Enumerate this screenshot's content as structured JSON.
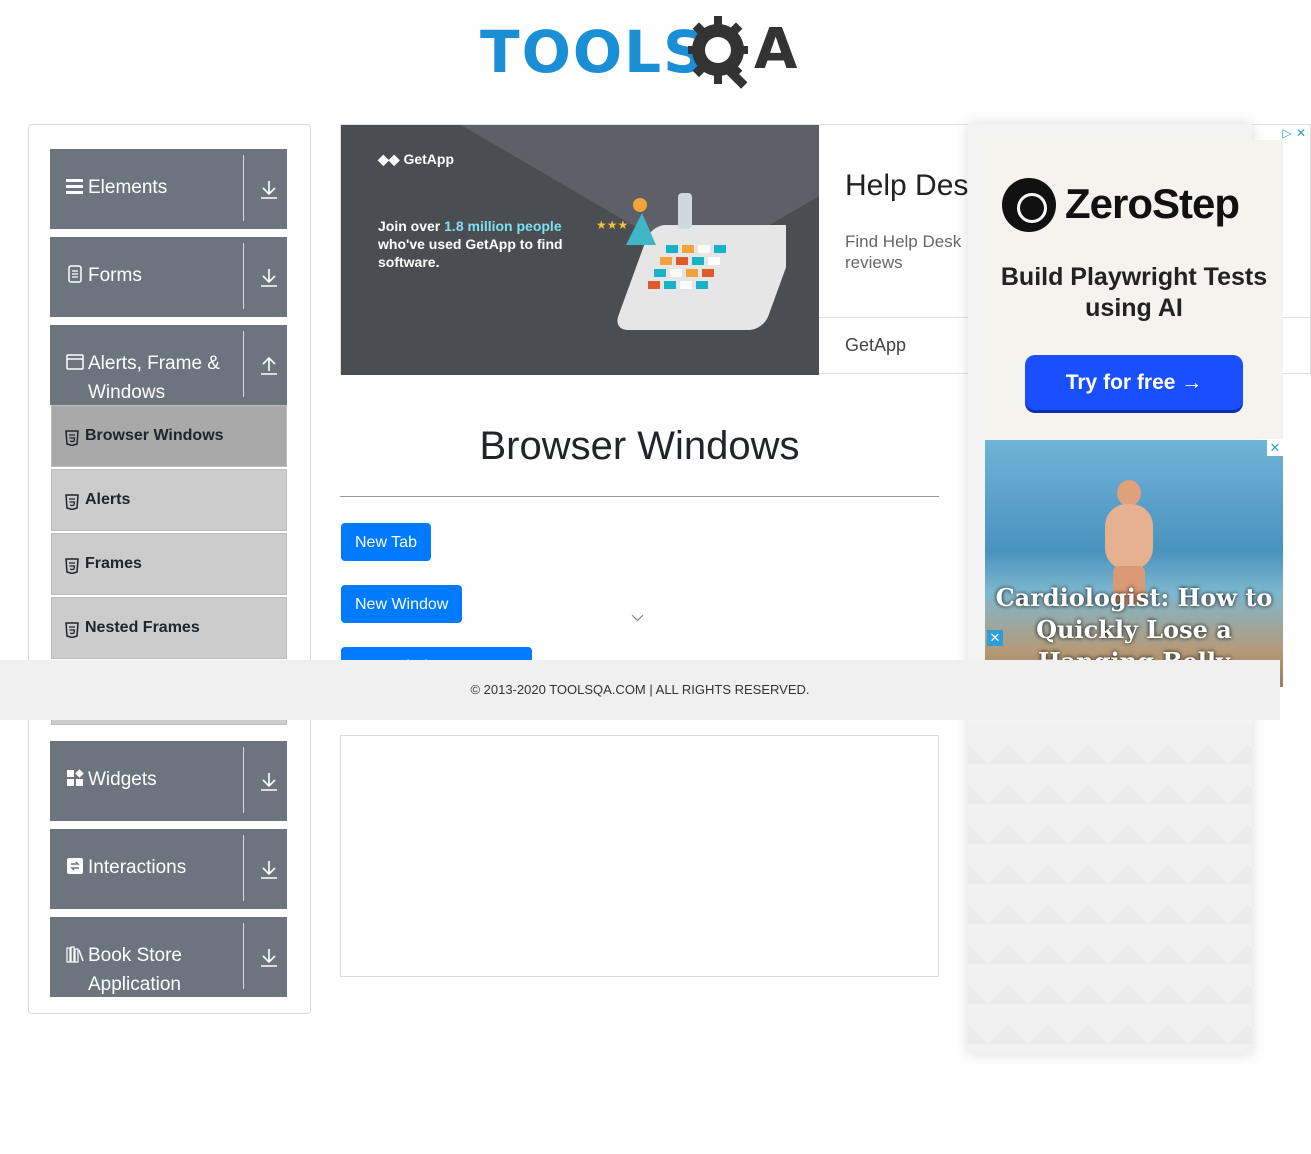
{
  "header": {
    "logo_text_left": "TOOLS",
    "logo_text_right": "A"
  },
  "sidebar": {
    "groups": [
      {
        "label": "Elements",
        "icon": "list-icon",
        "expanded": false
      },
      {
        "label": "Forms",
        "icon": "document-icon",
        "expanded": false
      },
      {
        "label": "Alerts, Frame & Windows",
        "icon": "window-icon",
        "expanded": true
      },
      {
        "label": "Widgets",
        "icon": "widgets-icon",
        "expanded": false
      },
      {
        "label": "Interactions",
        "icon": "interactions-icon",
        "expanded": false
      },
      {
        "label": "Book Store Application",
        "icon": "books-icon",
        "expanded": false
      }
    ],
    "menu_items": [
      {
        "label": "Browser Windows",
        "active": true
      },
      {
        "label": "Alerts",
        "active": false
      },
      {
        "label": "Frames",
        "active": false
      },
      {
        "label": "Nested Frames",
        "active": false
      }
    ]
  },
  "ad_banner": {
    "brand": "GetApp",
    "left_text_1": "Join over ",
    "left_text_highlight": "1.8 million people",
    "left_text_2": " who've used GetApp to find software.",
    "title": "Help Desl",
    "subtitle": "Find Help Desk reviews",
    "footer_brand": "GetApp"
  },
  "main": {
    "title": "Browser Windows",
    "buttons": {
      "new_tab": "New Tab",
      "new_window": "New Window",
      "new_window_message": "New Window Message"
    }
  },
  "right_ad": {
    "zerostep_name": "ZeroStep",
    "zerostep_tagline": "Build Playwright Tests using AI",
    "zerostep_button": "Try for free →",
    "beach_headline": "Cardiologist: How to Quickly Lose a Hanging Belly"
  },
  "footer": {
    "text": "© 2013-2020 TOOLSQA.COM | ALL RIGHTS RESERVED."
  },
  "colors": {
    "primary_button": "#007bff",
    "sidebar_group": "#6c757d",
    "menu_item": "#cccccc",
    "menu_item_active": "#a9a9a9",
    "logo_blue": "#1a8fd6"
  }
}
